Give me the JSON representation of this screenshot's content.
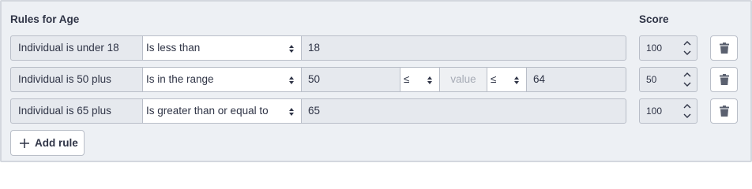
{
  "header": {
    "rules_title": "Rules for Age",
    "score_title": "Score"
  },
  "rules": [
    {
      "label": "Individual is under 18",
      "condition": "Is less than",
      "value": "18",
      "score": "100"
    },
    {
      "label": "Individual is 50 plus",
      "condition": "Is in the range",
      "value_from": "50",
      "op_from": "≤",
      "middle_placeholder": "value",
      "op_to": "≤",
      "value_to": "64",
      "score": "50"
    },
    {
      "label": "Individual is 65 plus",
      "condition": "Is greater than or equal to",
      "value": "65",
      "score": "100"
    }
  ],
  "add_rule_label": "Add rule",
  "icons": {
    "delete": "trash-icon",
    "add": "plus-icon",
    "select": "sort-caret-icon",
    "stepper": "spin-chevrons-icon"
  }
}
